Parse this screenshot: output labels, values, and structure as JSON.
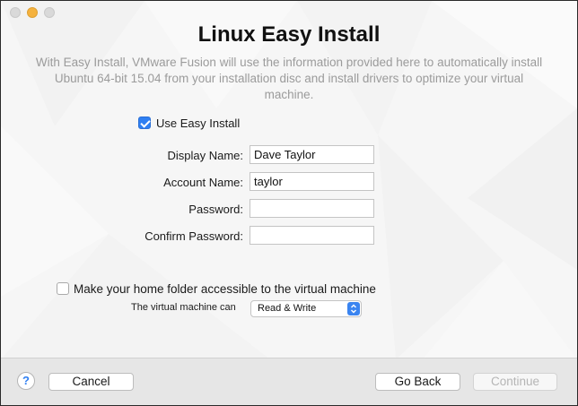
{
  "dialog": {
    "title": "Linux Easy Install",
    "description_lines": [
      "With Easy Install, VMware Fusion will use the information provided here to automatically install",
      "Ubuntu 64-bit 15.04 from your installation disc and install drivers to optimize your virtual",
      "machine."
    ]
  },
  "easy_install": {
    "label": "Use Easy Install",
    "checked": true
  },
  "form": {
    "display_name": {
      "label": "Display Name:",
      "value": "Dave Taylor"
    },
    "account_name": {
      "label": "Account Name:",
      "value": "taylor"
    },
    "password": {
      "label": "Password:",
      "value": ""
    },
    "confirm_password": {
      "label": "Confirm Password:",
      "value": ""
    }
  },
  "home_folder": {
    "label": "Make your home folder accessible to the virtual machine",
    "checked": false,
    "access_label": "The virtual machine can",
    "access_value": "Read & Write"
  },
  "footer": {
    "help_label": "?",
    "cancel_label": "Cancel",
    "go_back_label": "Go Back",
    "continue_label": "Continue"
  },
  "colors": {
    "accent": "#2f7ff2",
    "disabled_text": "#b5b5b5"
  }
}
